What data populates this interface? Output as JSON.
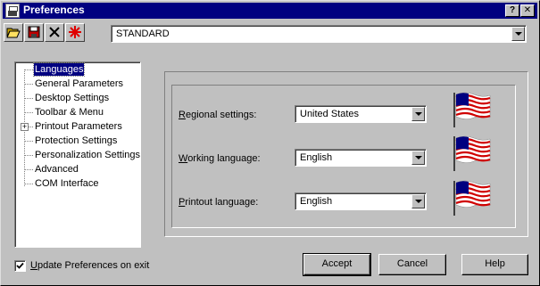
{
  "window": {
    "title": "Preferences",
    "help_button": "?",
    "close_button": "✕"
  },
  "toolbar": {
    "buttons": [
      "open-folder",
      "save",
      "delete",
      "reset"
    ],
    "profile_value": "STANDARD"
  },
  "tree": {
    "items": [
      {
        "label": "Languages",
        "selected": true
      },
      {
        "label": "General Parameters"
      },
      {
        "label": "Desktop Settings"
      },
      {
        "label": "Toolbar & Menu"
      },
      {
        "label": "Printout Parameters",
        "expandable": true,
        "expander": "+"
      },
      {
        "label": "Protection Settings"
      },
      {
        "label": "Personalization Settings"
      },
      {
        "label": "Advanced"
      },
      {
        "label": "COM Interface"
      }
    ]
  },
  "languages": {
    "regional": {
      "label_prefix": "R",
      "label_rest": "egional settings:",
      "value": "United States",
      "flag": "us-flag-icon"
    },
    "working": {
      "label_prefix": "W",
      "label_rest": "orking language:",
      "value": "English",
      "flag": "us-flag-icon"
    },
    "printout": {
      "label_prefix": "P",
      "label_rest": "rintout language:",
      "value": "English",
      "flag": "us-flag-icon"
    }
  },
  "footer": {
    "update_checkbox": {
      "checked": true,
      "label_prefix": "U",
      "label_rest": "pdate Preferences on exit"
    },
    "accept_label": "Accept",
    "cancel_label": "Cancel",
    "help_label": "Help"
  }
}
